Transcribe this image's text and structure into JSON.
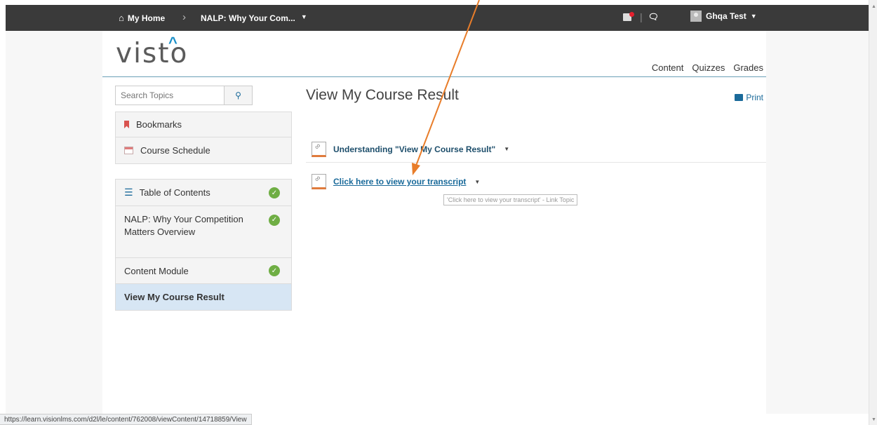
{
  "navbar": {
    "home_label": "My Home",
    "course_label": "NALP: Why Your Com...",
    "user_name": "Ghqa Test"
  },
  "header": {
    "logo": "visto",
    "nav": [
      "Content",
      "Quizzes",
      "Grades"
    ]
  },
  "sidebar": {
    "search_placeholder": "Search Topics",
    "group1": [
      {
        "label": "Bookmarks",
        "icon": "bookmark-icon"
      },
      {
        "label": "Course Schedule",
        "icon": "calendar-icon"
      }
    ],
    "group2": [
      {
        "label": "Table of Contents",
        "completed": true
      },
      {
        "label": "NALP: Why Your Competition Matters Overview",
        "completed": true
      },
      {
        "label": "Content Module",
        "completed": true
      },
      {
        "label": "View My Course Result",
        "completed": false,
        "active": true
      }
    ]
  },
  "main": {
    "title": "View My Course Result",
    "print_label": "Print",
    "topics": [
      {
        "title": "Understanding \"View My Course Result\""
      },
      {
        "title": "Click here to view your transcript"
      }
    ],
    "tooltip": "'Click here to view your transcript' - Link Topic"
  },
  "status_url": "https://learn.visionlms.com/d2l/le/content/762008/viewContent/14718859/View",
  "colors": {
    "navbar_bg": "#3a3a3a",
    "accent_link": "#1a6a9a",
    "check_green": "#6fae44",
    "active_item_bg": "#d7e6f4",
    "annotation_arrow": "#e87d2a"
  }
}
